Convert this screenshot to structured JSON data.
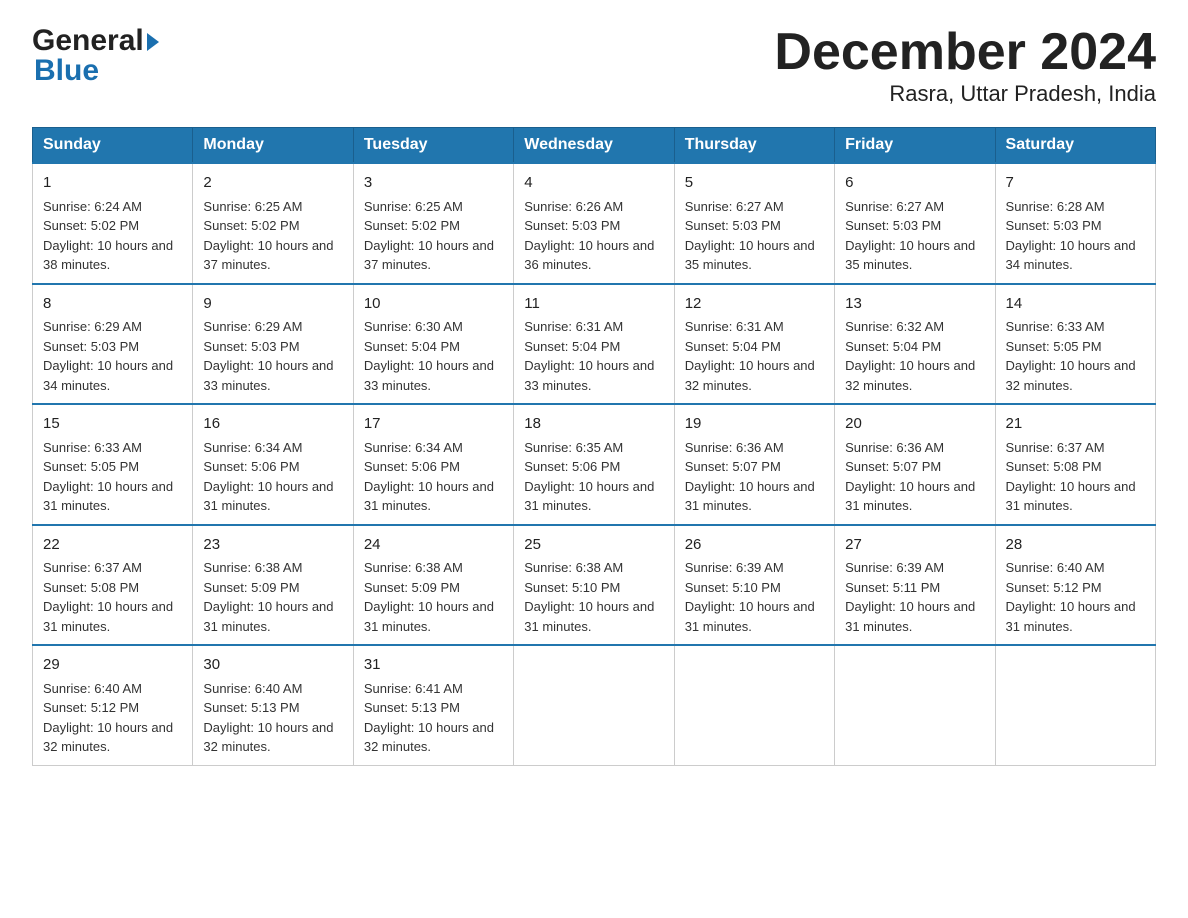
{
  "header": {
    "title": "December 2024",
    "subtitle": "Rasra, Uttar Pradesh, India",
    "logo_general": "General",
    "logo_blue": "Blue"
  },
  "calendar": {
    "days_of_week": [
      "Sunday",
      "Monday",
      "Tuesday",
      "Wednesday",
      "Thursday",
      "Friday",
      "Saturday"
    ],
    "weeks": [
      [
        {
          "day": "1",
          "sunrise": "6:24 AM",
          "sunset": "5:02 PM",
          "daylight": "10 hours and 38 minutes."
        },
        {
          "day": "2",
          "sunrise": "6:25 AM",
          "sunset": "5:02 PM",
          "daylight": "10 hours and 37 minutes."
        },
        {
          "day": "3",
          "sunrise": "6:25 AM",
          "sunset": "5:02 PM",
          "daylight": "10 hours and 37 minutes."
        },
        {
          "day": "4",
          "sunrise": "6:26 AM",
          "sunset": "5:03 PM",
          "daylight": "10 hours and 36 minutes."
        },
        {
          "day": "5",
          "sunrise": "6:27 AM",
          "sunset": "5:03 PM",
          "daylight": "10 hours and 35 minutes."
        },
        {
          "day": "6",
          "sunrise": "6:27 AM",
          "sunset": "5:03 PM",
          "daylight": "10 hours and 35 minutes."
        },
        {
          "day": "7",
          "sunrise": "6:28 AM",
          "sunset": "5:03 PM",
          "daylight": "10 hours and 34 minutes."
        }
      ],
      [
        {
          "day": "8",
          "sunrise": "6:29 AM",
          "sunset": "5:03 PM",
          "daylight": "10 hours and 34 minutes."
        },
        {
          "day": "9",
          "sunrise": "6:29 AM",
          "sunset": "5:03 PM",
          "daylight": "10 hours and 33 minutes."
        },
        {
          "day": "10",
          "sunrise": "6:30 AM",
          "sunset": "5:04 PM",
          "daylight": "10 hours and 33 minutes."
        },
        {
          "day": "11",
          "sunrise": "6:31 AM",
          "sunset": "5:04 PM",
          "daylight": "10 hours and 33 minutes."
        },
        {
          "day": "12",
          "sunrise": "6:31 AM",
          "sunset": "5:04 PM",
          "daylight": "10 hours and 32 minutes."
        },
        {
          "day": "13",
          "sunrise": "6:32 AM",
          "sunset": "5:04 PM",
          "daylight": "10 hours and 32 minutes."
        },
        {
          "day": "14",
          "sunrise": "6:33 AM",
          "sunset": "5:05 PM",
          "daylight": "10 hours and 32 minutes."
        }
      ],
      [
        {
          "day": "15",
          "sunrise": "6:33 AM",
          "sunset": "5:05 PM",
          "daylight": "10 hours and 31 minutes."
        },
        {
          "day": "16",
          "sunrise": "6:34 AM",
          "sunset": "5:06 PM",
          "daylight": "10 hours and 31 minutes."
        },
        {
          "day": "17",
          "sunrise": "6:34 AM",
          "sunset": "5:06 PM",
          "daylight": "10 hours and 31 minutes."
        },
        {
          "day": "18",
          "sunrise": "6:35 AM",
          "sunset": "5:06 PM",
          "daylight": "10 hours and 31 minutes."
        },
        {
          "day": "19",
          "sunrise": "6:36 AM",
          "sunset": "5:07 PM",
          "daylight": "10 hours and 31 minutes."
        },
        {
          "day": "20",
          "sunrise": "6:36 AM",
          "sunset": "5:07 PM",
          "daylight": "10 hours and 31 minutes."
        },
        {
          "day": "21",
          "sunrise": "6:37 AM",
          "sunset": "5:08 PM",
          "daylight": "10 hours and 31 minutes."
        }
      ],
      [
        {
          "day": "22",
          "sunrise": "6:37 AM",
          "sunset": "5:08 PM",
          "daylight": "10 hours and 31 minutes."
        },
        {
          "day": "23",
          "sunrise": "6:38 AM",
          "sunset": "5:09 PM",
          "daylight": "10 hours and 31 minutes."
        },
        {
          "day": "24",
          "sunrise": "6:38 AM",
          "sunset": "5:09 PM",
          "daylight": "10 hours and 31 minutes."
        },
        {
          "day": "25",
          "sunrise": "6:38 AM",
          "sunset": "5:10 PM",
          "daylight": "10 hours and 31 minutes."
        },
        {
          "day": "26",
          "sunrise": "6:39 AM",
          "sunset": "5:10 PM",
          "daylight": "10 hours and 31 minutes."
        },
        {
          "day": "27",
          "sunrise": "6:39 AM",
          "sunset": "5:11 PM",
          "daylight": "10 hours and 31 minutes."
        },
        {
          "day": "28",
          "sunrise": "6:40 AM",
          "sunset": "5:12 PM",
          "daylight": "10 hours and 31 minutes."
        }
      ],
      [
        {
          "day": "29",
          "sunrise": "6:40 AM",
          "sunset": "5:12 PM",
          "daylight": "10 hours and 32 minutes."
        },
        {
          "day": "30",
          "sunrise": "6:40 AM",
          "sunset": "5:13 PM",
          "daylight": "10 hours and 32 minutes."
        },
        {
          "day": "31",
          "sunrise": "6:41 AM",
          "sunset": "5:13 PM",
          "daylight": "10 hours and 32 minutes."
        },
        null,
        null,
        null,
        null
      ]
    ],
    "labels": {
      "sunrise": "Sunrise: ",
      "sunset": "Sunset: ",
      "daylight": "Daylight: "
    }
  }
}
